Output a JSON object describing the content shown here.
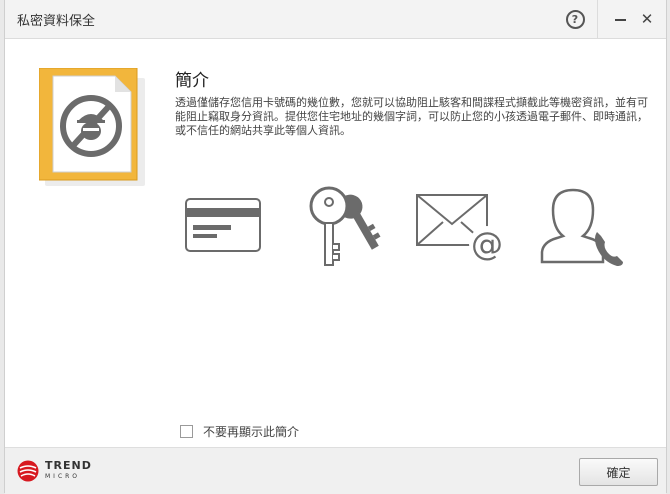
{
  "window": {
    "title": "私密資料保全"
  },
  "titlebar": {
    "help_label": "?",
    "minimize_label": "–",
    "close_label": "✕"
  },
  "content": {
    "heading": "簡介",
    "description": "透過僅儲存您信用卡號碼的幾位數，您就可以協助阻止駭客和間諜程式擷截此等機密資訊，並有可能阻止竊取身分資訊。提供您住宅地址的幾個字詞，可以防止您的小孩透過電子郵件、即時通訊，或不信任的網站共享此等個人資訊。",
    "features": [
      {
        "icon": "credit-card-icon"
      },
      {
        "icon": "key-icon"
      },
      {
        "icon": "email-icon"
      },
      {
        "icon": "contact-phone-icon"
      }
    ],
    "checkbox_label": "不要再顯示此簡介"
  },
  "footer": {
    "logo_line1": "TREND",
    "logo_line2": "MICRO",
    "ok_label": "確定"
  },
  "colors": {
    "accent": "#f2b63c",
    "brand_red": "#d71920",
    "icon_gray": "#6b6b6b"
  }
}
